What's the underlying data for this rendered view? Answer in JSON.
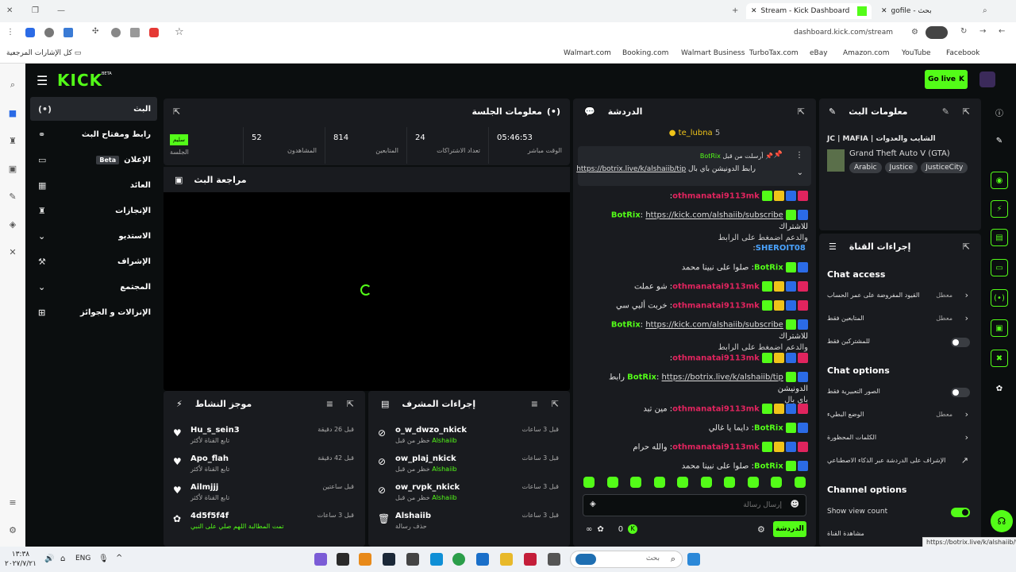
{
  "browser": {
    "tabs": [
      {
        "label": "Stream - Kick Dashboard",
        "active": true
      },
      {
        "label": "gofile - بحث",
        "active": false
      }
    ],
    "url": "dashboard.kick.com/stream",
    "bookmarks_label": "كل الإشارات المرجعية",
    "bookmarks": [
      "Walmart.com",
      "Booking.com",
      "Walmart Business",
      "TurboTax.com",
      "eBay",
      "Amazon.com",
      "YouTube",
      "Facebook"
    ]
  },
  "topnav": {
    "logo": "KICK",
    "logo_badge": "BETA",
    "go_live": "Go live"
  },
  "sidenav": {
    "items": [
      {
        "label": "البث",
        "active": true
      },
      {
        "label": "رابط ومفتاح البث"
      },
      {
        "label": "الإعلان",
        "badge": "Beta"
      },
      {
        "label": "العائد"
      },
      {
        "label": "الإنجازات"
      },
      {
        "label": "الاستديو"
      },
      {
        "label": "الإشراف"
      },
      {
        "label": "المجتمع"
      },
      {
        "label": "الإنزالات و الجوائز"
      }
    ]
  },
  "session": {
    "title": "معلومات الجلسة",
    "live_tag": "سليم",
    "live_label": "الجلسة",
    "stats": [
      {
        "value": "52",
        "label": "المشاهدون"
      },
      {
        "value": "814",
        "label": "المتابعين"
      },
      {
        "value": "24",
        "label": "تعداد الاشتراكات"
      },
      {
        "value": "05:46:53",
        "label": "الوقت مباشر"
      }
    ]
  },
  "preview": {
    "title": "مراجعة البث"
  },
  "activity": {
    "title": "موجز النشاط",
    "items": [
      {
        "user": "Hu_s_sein3",
        "sub": "تابع القناة لأكثر",
        "time": "قبل 26 دقيقة"
      },
      {
        "user": "Apo_flah",
        "sub": "تابع القناة لأكثر",
        "time": "قبل 42 دقيقة"
      },
      {
        "user": "Ailmjjj",
        "sub": "تابع القناة لأكثر",
        "time": "قبل ساعتين"
      },
      {
        "user": "4d5f5f4f",
        "sub": "تمت المطالبة اللهم صلي على النبي",
        "time": "قبل 3 ساعات"
      }
    ]
  },
  "modactions": {
    "title": "إجراءات المشرف",
    "items": [
      {
        "user": "o_w_dwzo_nkick",
        "sub": "خظر من قبل",
        "by": "Alshaiib",
        "time": "قبل 3 ساعات"
      },
      {
        "user": "ow_plaj_nkick",
        "sub": "خظر من قبل",
        "by": "Alshaiib",
        "time": "قبل 3 ساعات"
      },
      {
        "user": "ow_rvpk_nkick",
        "sub": "خظر من قبل",
        "by": "Alshaiib",
        "time": "قبل 3 ساعات"
      },
      {
        "user": "Alshaiib",
        "sub": "حذف رسالة",
        "by": "",
        "time": "قبل 3 ساعات"
      }
    ]
  },
  "chat": {
    "title": "الدردشة",
    "top_user": "te_lubna",
    "top_count": "5",
    "pinned_by": "أرسلت من قبل",
    "pinned_user": "BotRix",
    "pinned_text": "رابط الدونيشن باي بال",
    "pinned_link": "https://botrix.live/k/alshaiib/tip",
    "messages": [
      {
        "user": "othmanatai9113mk",
        "type": "red",
        "text": ""
      },
      {
        "user": "BotRix",
        "type": "green",
        "link": "https://kick.com/alshaiib/subscribe",
        "text": "للاشتراك",
        "extra": "والدعم اضمغط على الرابط"
      },
      {
        "user": "SHEROIT08",
        "type": "blue",
        "text": ""
      },
      {
        "user": "BotRix",
        "type": "green",
        "text": "صلوا على نبينا محمد"
      },
      {
        "user": "othmanatai9113mk",
        "type": "red",
        "text": "شو عملت"
      },
      {
        "user": "othmanatai9113mk",
        "type": "red",
        "text": "خربت ألبي سي"
      },
      {
        "user": "BotRix",
        "type": "green",
        "link": "https://kick.com/alshaiib/subscribe",
        "text": "للاشتراك",
        "extra": "والدعم اضمغط على الرابط"
      },
      {
        "user": "othmanatai9113mk",
        "type": "red",
        "text": ""
      },
      {
        "user": "BotRix",
        "type": "green",
        "link": "https://botrix.live/k/alshaiib/tip",
        "text": "رابط الدونيشن",
        "extra": "باي بال"
      },
      {
        "user": "othmanatai9113mk",
        "type": "red",
        "text": "مين تبد"
      },
      {
        "user": "BotRix",
        "type": "green",
        "text": "دايما يا غالي"
      },
      {
        "user": "othmanatai9113mk",
        "type": "red",
        "text": "والله حرام"
      },
      {
        "user": "BotRix",
        "type": "green",
        "text": "صلوا على نبينا محمد"
      }
    ],
    "input_placeholder": "إرسال رسالة",
    "count": "0",
    "send": "الدردشة"
  },
  "streaminfo": {
    "title": "معلومات البث",
    "stream_title": "JC | MAFIA | الشايب والعدوات",
    "game": "Grand Theft Auto V (GTA)",
    "tags": [
      "Arabic",
      "Justice",
      "JusticeCity"
    ]
  },
  "channel": {
    "title": "إجراءات القناة",
    "chat_access": "Chat access",
    "access_rows": [
      {
        "label": "القيود المفروضة على عمر الحساب",
        "value": "معطل"
      },
      {
        "label": "المتابعين فقط",
        "value": "معطل"
      },
      {
        "label": "للمشتركين فقط",
        "toggle": false
      }
    ],
    "chat_options": "Chat options",
    "option_rows": [
      {
        "label": "الصور التعبيرية فقط",
        "toggle": false
      },
      {
        "label": "الوضع البطيء",
        "value": "معطل"
      },
      {
        "label": "الكلمات المحظورة",
        "value": ""
      },
      {
        "label": "الإشراف على الدردشة عبر الذكاء الاصطناعي",
        "value": ""
      }
    ],
    "channel_options": "Channel options",
    "show_view_count": "Show view count",
    "show_view_on": true,
    "last_row": "مشاهدة القناة"
  },
  "statusbar_url": "https://botrix.live/k/alshaiib/tip",
  "taskbar": {
    "search": "بحث",
    "lang": "ENG",
    "time": "١٣:٣٨",
    "date": "٢٠٢٧/٧/٢١"
  },
  "colors": {
    "accent": "#53fc18",
    "bg": "#0b0e0f",
    "panel": "#191b1f"
  }
}
